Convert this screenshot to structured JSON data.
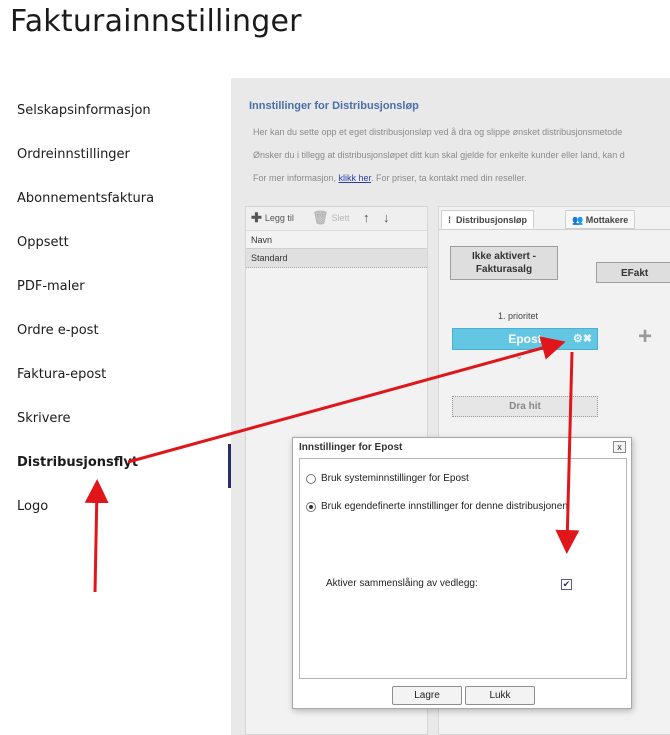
{
  "page": {
    "title": "Fakturainnstillinger"
  },
  "sidebar": {
    "items": [
      {
        "label": "Selskapsinformasjon"
      },
      {
        "label": "Ordreinnstillinger"
      },
      {
        "label": "Abonnementsfaktura"
      },
      {
        "label": "Oppsett"
      },
      {
        "label": "PDF-maler"
      },
      {
        "label": "Ordre e-post"
      },
      {
        "label": "Faktura-epost"
      },
      {
        "label": "Skrivere"
      },
      {
        "label": "Distribusjonsflyt"
      },
      {
        "label": "Logo"
      }
    ],
    "active": "Distribusjonsflyt"
  },
  "main": {
    "section_title": "Innstillinger for Distribusjonsløp",
    "desc_line1": "Her kan du sette opp et eget distribusjonsløp ved å dra og slippe ønsket distribusjonsmetode",
    "desc_line2": "Ønsker du i tillegg at distribusjonsløpet ditt kun skal gjelde for enkelte kunder eller land, kan d",
    "desc_line3_prefix": "For mer informasjon, ",
    "desc_link": "klikk her",
    "desc_line3_suffix": ". For priser, ta kontakt med din reseller."
  },
  "list_panel": {
    "toolbar": {
      "add_label": "Legg til",
      "delete_label": "Slett"
    },
    "column_header": "Navn",
    "rows": [
      "Standard"
    ]
  },
  "flow_panel": {
    "tabs": [
      "Distribusjonsløp",
      "Mottakere"
    ],
    "stage_buttons": [
      {
        "line1": "Ikke aktivert -",
        "line2": "Fakturasalg"
      },
      {
        "line1": "EFakt",
        "line2": ""
      }
    ],
    "priority_label": "1. prioritet",
    "chip_label": "Epost",
    "drop_zone_label": "Dra hit"
  },
  "dialog": {
    "title": "Innstillinger for Epost",
    "close_label": "x",
    "radio_system": "Bruk systeminnstillinger for Epost",
    "radio_custom": "Bruk egendefinerte innstillinger for denne distribusjonen",
    "selected": "custom",
    "checkbox_label": "Aktiver sammenslåing av vedlegg:",
    "checkbox_checked": true,
    "save_label": "Lagre",
    "close_button_label": "Lukk"
  },
  "colors": {
    "link": "#2a3fae",
    "section_title": "#4a6ea9",
    "chip": "#63c6e3",
    "annotation_arrow": "#e0161b",
    "active_bar": "#2a2a6e"
  }
}
